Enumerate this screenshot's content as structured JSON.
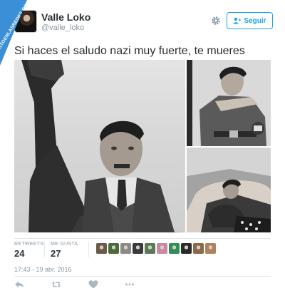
{
  "watermark": {
    "text": "VISTOENLASREDES.COM"
  },
  "tweet": {
    "author_name": "Valle Loko",
    "author_handle": "@valle_loko",
    "follow_label": "Seguir",
    "text": "Si haces el saludo nazi muy fuerte, te mueres",
    "timestamp": "17:43 - 19 abr. 2016"
  },
  "stats": {
    "retweets_label": "RETWEETS",
    "retweets_value": "24",
    "likes_label": "ME GUSTA",
    "likes_value": "27"
  },
  "likers": [
    "#6b5a4a",
    "#4a6b3a",
    "#8a8a8a",
    "#3a3a3a",
    "#5c7a5a",
    "#c98aa0",
    "#2f8f55",
    "#2a2a2a",
    "#8a6a4a",
    "#b08060"
  ],
  "icons": {
    "gear": "gear-icon",
    "follow": "add-user-icon",
    "reply": "reply-icon",
    "retweet": "retweet-icon",
    "like": "heart-icon",
    "more": "more-icon"
  },
  "colors": {
    "accent": "#1da1f2",
    "muted": "#8899a6",
    "text": "#292f33"
  }
}
